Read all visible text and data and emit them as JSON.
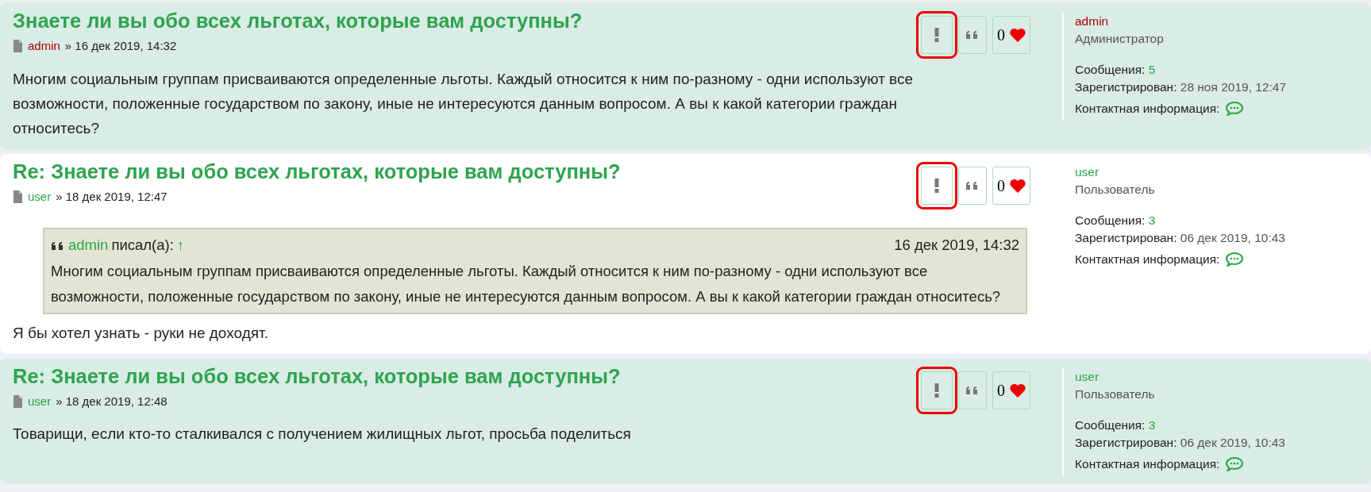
{
  "posts": [
    {
      "shaded": true,
      "title": "Знаете ли вы обо всех льготах, которые вам доступны?",
      "author": {
        "name": "admin",
        "color": "#aa0000"
      },
      "separator": "»",
      "date": "16 дек 2019, 14:32",
      "report_highlighted": true,
      "likes": "0",
      "body": "Многим социальным группам присваиваются определенные льготы. Каждый относится к ним по-разному - одни используют все возможности, положенные государством по закону, иные не интересуются данным вопросом. А вы к какой категории граждан относитесь?",
      "profile": {
        "name": "admin",
        "rank": "Администратор",
        "posts_label": "Сообщения:",
        "posts": "5",
        "registered_label": "Зарегистрирован:",
        "registered": "28 ноя 2019, 12:47",
        "contact_label": "Контактная информация:"
      }
    },
    {
      "shaded": false,
      "title": "Re: Знаете ли вы обо всех льготах, которые вам доступны?",
      "author": {
        "name": "user",
        "color": "#28a745"
      },
      "separator": "»",
      "date": "18 дек 2019, 12:47",
      "report_highlighted": true,
      "likes": "0",
      "quote": {
        "author": "admin",
        "wrote": "писал(а):",
        "up": "↑",
        "date": "16 дек 2019, 14:32",
        "text": "Многим социальным группам присваиваются определенные льготы. Каждый относится к ним по-разному - одни используют все возможности, положенные государством по закону, иные не интересуются данным вопросом. А вы к какой категории граждан относитесь?"
      },
      "body": "Я бы хотел узнать - руки не доходят.",
      "profile": {
        "name": "user",
        "rank": "Пользователь",
        "posts_label": "Сообщения:",
        "posts": "3",
        "registered_label": "Зарегистрирован:",
        "registered": "06 дек 2019, 10:43",
        "contact_label": "Контактная информация:"
      }
    },
    {
      "shaded": true,
      "title": "Re: Знаете ли вы обо всех льготах, которые вам доступны?",
      "author": {
        "name": "user",
        "color": "#28a745"
      },
      "separator": "»",
      "date": "18 дек 2019, 12:48",
      "report_highlighted": true,
      "likes": "0",
      "body": "Товарищи, если кто-то сталкивался с получением жилищных льгот, просьба поделиться",
      "profile": {
        "name": "user",
        "rank": "Пользователь",
        "posts_label": "Сообщения:",
        "posts": "3",
        "registered_label": "Зарегистрирован:",
        "registered": "06 дек 2019, 10:43",
        "contact_label": "Контактная информация:"
      }
    }
  ]
}
